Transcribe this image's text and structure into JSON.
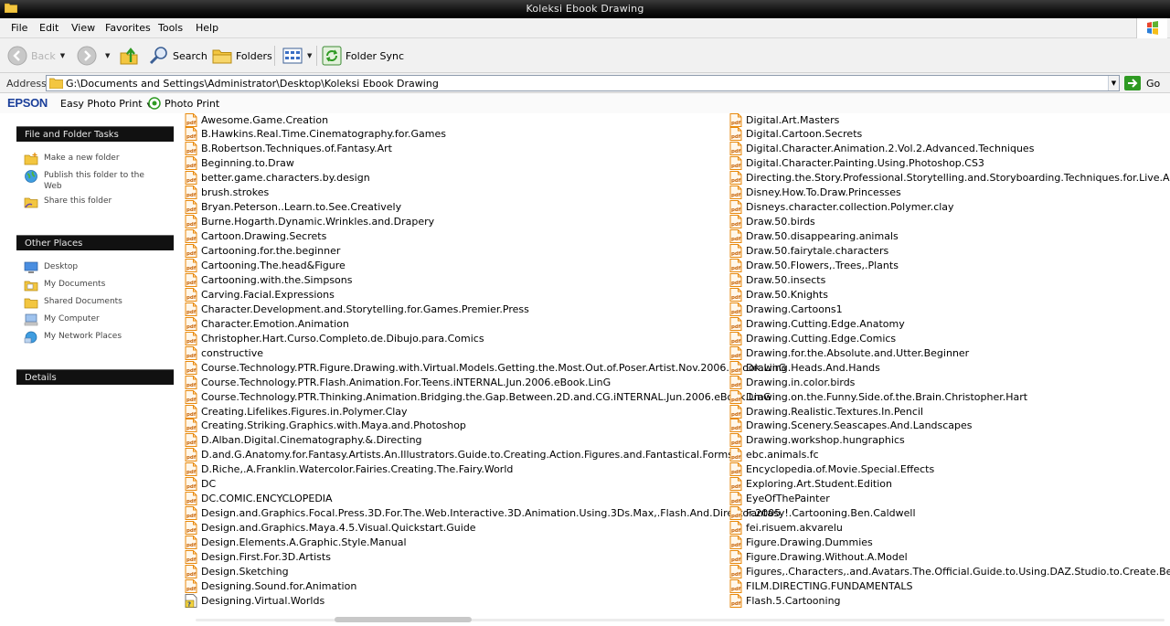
{
  "window": {
    "title": "Koleksi Ebook Drawing"
  },
  "menu": [
    "File",
    "Edit",
    "View",
    "Favorites",
    "Tools",
    "Help"
  ],
  "toolbar": {
    "back": "Back",
    "search": "Search",
    "folders": "Folders",
    "folder_sync": "Folder Sync"
  },
  "address": {
    "label": "Address",
    "path": "G:\\Documents and Settings\\Administrator\\Desktop\\Koleksi Ebook Drawing",
    "go": "Go"
  },
  "epson": {
    "logo": "EPSON",
    "easy_photo_print": "Easy Photo Print",
    "photo_print": "Photo Print"
  },
  "taskpane": {
    "tasks_header": "File and Folder Tasks",
    "tasks": [
      "Make a new folder",
      "Publish this folder to the Web",
      "Share this folder"
    ],
    "places_header": "Other Places",
    "places": [
      "Desktop",
      "My Documents",
      "Shared Documents",
      "My Computer",
      "My Network Places"
    ],
    "details_header": "Details"
  },
  "files": {
    "column1": [
      "Awesome.Game.Creation",
      "B.Hawkins.Real.Time.Cinematography.for.Games",
      "B.Robertson.Techniques.of.Fantasy.Art",
      "Beginning.to.Draw",
      "better.game.characters.by.design",
      "brush.strokes",
      "Bryan.Peterson..Learn.to.See.Creatively",
      "Burne.Hogarth.Dynamic.Wrinkles.and.Drapery",
      "Cartoon.Drawing.Secrets",
      "Cartooning.for.the.beginner",
      "Cartooning.The.head&Figure",
      "Cartooning.with.the.Simpsons",
      "Carving.Facial.Expressions",
      "Character.Development.and.Storytelling.for.Games.Premier.Press",
      "Character.Emotion.Animation",
      "Christopher.Hart.Curso.Completo.de.Dibujo.para.Comics",
      "constructive",
      "Course.Technology.PTR.Figure.Drawing.with.Virtual.Models.Getting.the.Most.Out.of.Poser.Artist.Nov.2006.eBook.LinG",
      "Course.Technology.PTR.Flash.Animation.For.Teens.iNTERNAL.Jun.2006.eBook.LinG",
      "Course.Technology.PTR.Thinking.Animation.Bridging.the.Gap.Between.2D.and.CG.iNTERNAL.Jun.2006.eBook.LinG",
      "Creating.Lifelikes.Figures.in.Polymer.Clay",
      "Creating.Striking.Graphics.with.Maya.and.Photoshop",
      "D.Alban.Digital.Cinematography.&.Directing",
      "D.and.G.Anatomy.for.Fantasy.Artists.An.Illustrators.Guide.to.Creating.Action.Figures.and.Fantastical.Forms",
      "D.Riche,.A.Franklin.Watercolor.Fairies.Creating.The.Fairy.World",
      "DC",
      "DC.COMIC.ENCYCLOPEDIA",
      "Design.and.Graphics.Focal.Press.3D.For.The.Web.Interactive.3D.Animation.Using.3Ds.Max,.Flash.And.Director.2005",
      "Design.and.Graphics.Maya.4.5.Visual.Quickstart.Guide",
      "Design.Elements.A.Graphic.Style.Manual",
      "Design.First.For.3D.Artists",
      "Design.Sketching",
      "Designing.Sound.for.Animation",
      "Designing.Virtual.Worlds"
    ],
    "column2": [
      "Digital.Art.Masters",
      "Digital.Cartoon.Secrets",
      "Digital.Character.Animation.2.Vol.2.Advanced.Techniques",
      "Digital.Character.Painting.Using.Photoshop.CS3",
      "Directing.the.Story.Professional.Storytelling.and.Storyboarding.Techniques.for.Live.Action.and.A",
      "Disney.How.To.Draw.Princesses",
      "Disneys.character.collection.Polymer.clay",
      "Draw.50.birds",
      "Draw.50.disappearing.animals",
      "Draw.50.fairytale.characters",
      "Draw.50.Flowers,.Trees,.Plants",
      "Draw.50.insects",
      "Draw.50.Knights",
      "Drawing.Cartoons1",
      "Drawing.Cutting.Edge.Anatomy",
      "Drawing.Cutting.Edge.Comics",
      "Drawing.for.the.Absolute.and.Utter.Beginner",
      "Drawing.Heads.And.Hands",
      "Drawing.in.color.birds",
      "Drawing.on.the.Funny.Side.of.the.Brain.Christopher.Hart",
      "Drawing.Realistic.Textures.In.Pencil",
      "Drawing.Scenery.Seascapes.And.Landscapes",
      "Drawing.workshop.hungraphics",
      "ebc.animals.fc",
      "Encyclopedia.of.Movie.Special.Effects",
      "Exploring.Art.Student.Edition",
      "EyeOfThePainter",
      "Fantasy!.Cartooning.Ben.Caldwell",
      "fei.risuem.akvarelu",
      "Figure.Drawing.Dummies",
      "Figure.Drawing.Without.A.Model",
      "Figures,.Characters,.and.Avatars.The.Official.Guide.to.Using.DAZ.Studio.to.Create.Beautiful.Art",
      "FILM.DIRECTING.FUNDAMENTALS",
      "Flash.5.Cartooning"
    ]
  },
  "colors": {
    "pdf_icon": "#e8890c",
    "panel_header": "#111111",
    "epson_blue": "#1b3f9a"
  }
}
